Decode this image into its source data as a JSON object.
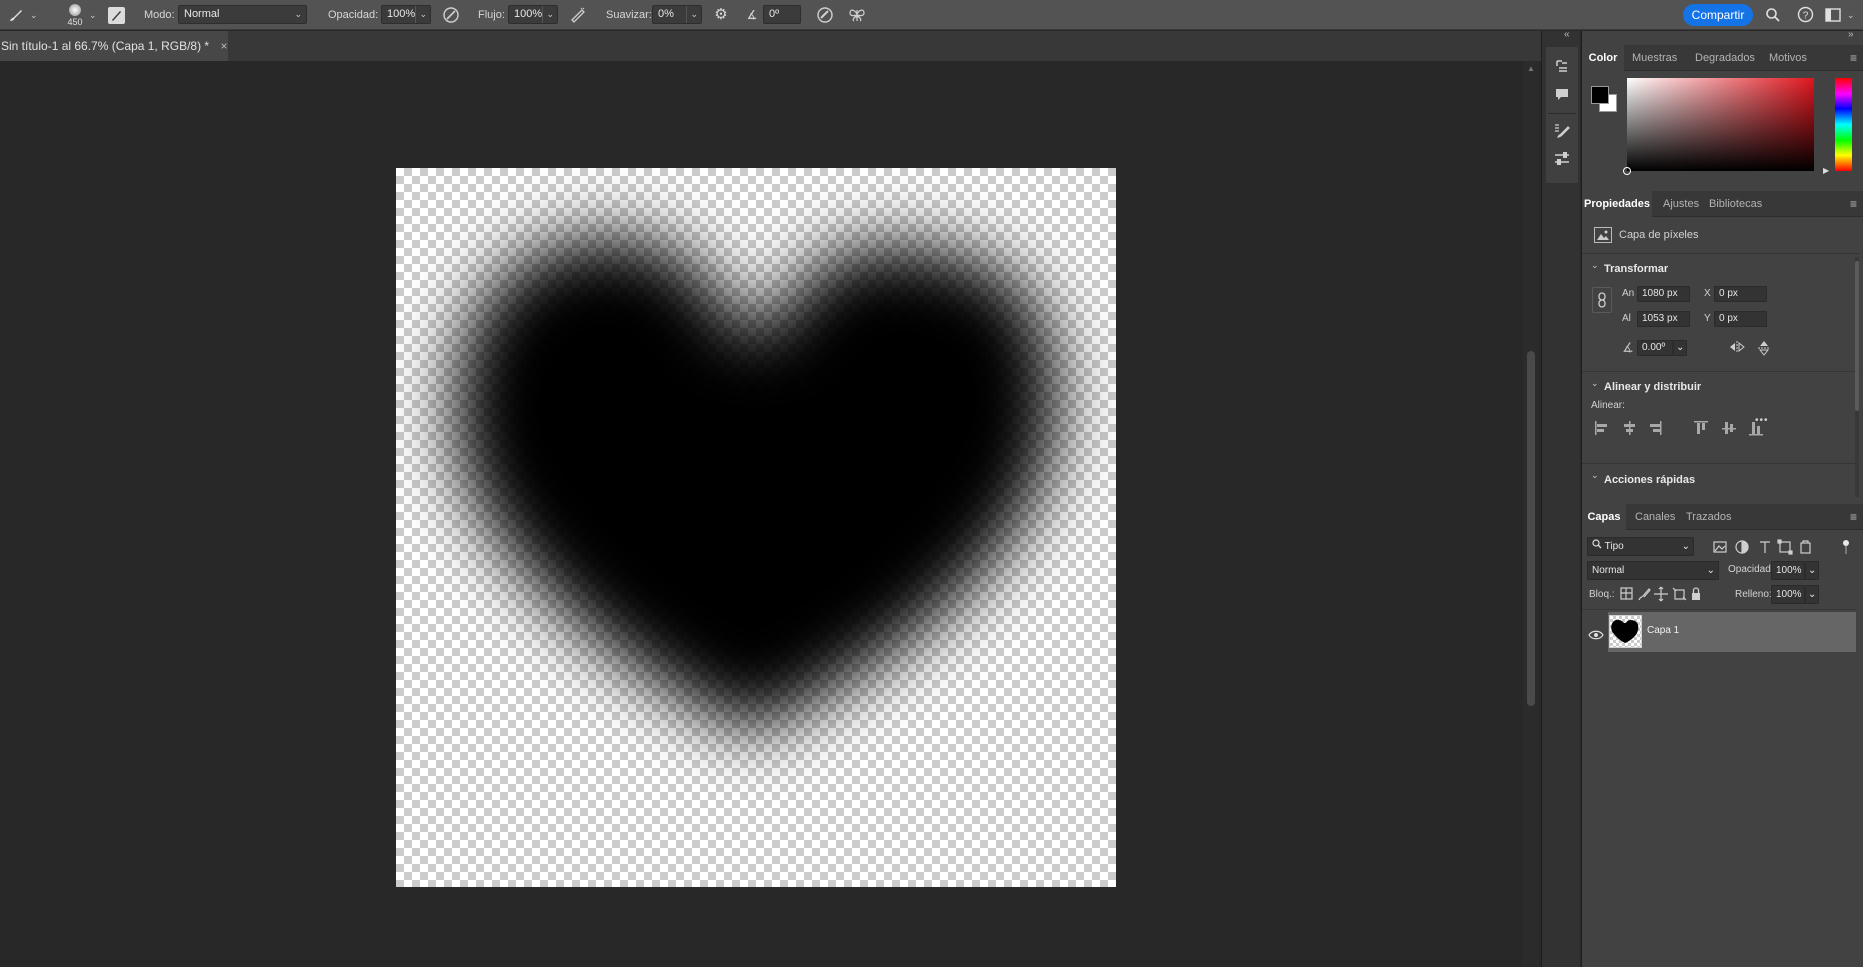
{
  "optionsbar": {
    "brush_size": "450",
    "mode_label": "Modo:",
    "mode_value": "Normal",
    "opacity_label": "Opacidad:",
    "opacity_value": "100%",
    "flow_label": "Flujo:",
    "flow_value": "100%",
    "smoothing_label": "Suavizar:",
    "smoothing_value": "0%",
    "angle_value": "0º",
    "share_label": "Compartir"
  },
  "document": {
    "tab_title": "Sin título-1 al 66.7% (Capa 1, RGB/8) *",
    "close_glyph": "×"
  },
  "color_panel": {
    "tabs": [
      "Color",
      "Muestras",
      "Degradados",
      "Motivos"
    ],
    "active_tab": 0,
    "foreground": "#000000",
    "background": "#ffffff",
    "hue_base": "#e0161e"
  },
  "properties_panel": {
    "tabs": [
      "Propiedades",
      "Ajustes",
      "Bibliotecas"
    ],
    "active_tab": 0,
    "layer_kind": "Capa de píxeles",
    "transform": {
      "title": "Transformar",
      "w_label": "An",
      "w_value": "1080 px",
      "h_label": "Al",
      "h_value": "1053 px",
      "x_label": "X",
      "x_value": "0 px",
      "y_label": "Y",
      "y_value": "0 px",
      "angle_value": "0.00º"
    },
    "align": {
      "title": "Alinear y distribuir",
      "subtitle": "Alinear:",
      "more": "•••"
    },
    "quick_actions": {
      "title": "Acciones rápidas"
    }
  },
  "layers_panel": {
    "tabs": [
      "Capas",
      "Canales",
      "Trazados"
    ],
    "active_tab": 0,
    "filter_value": "Tipo",
    "blend_mode": "Normal",
    "opacity_label": "Opacidad:",
    "opacity_value": "100%",
    "lock_label": "Bloq.:",
    "fill_label": "Relleno:",
    "fill_value": "100%",
    "layers": [
      {
        "name": "Capa 1",
        "visible": true,
        "selected": true
      }
    ]
  }
}
